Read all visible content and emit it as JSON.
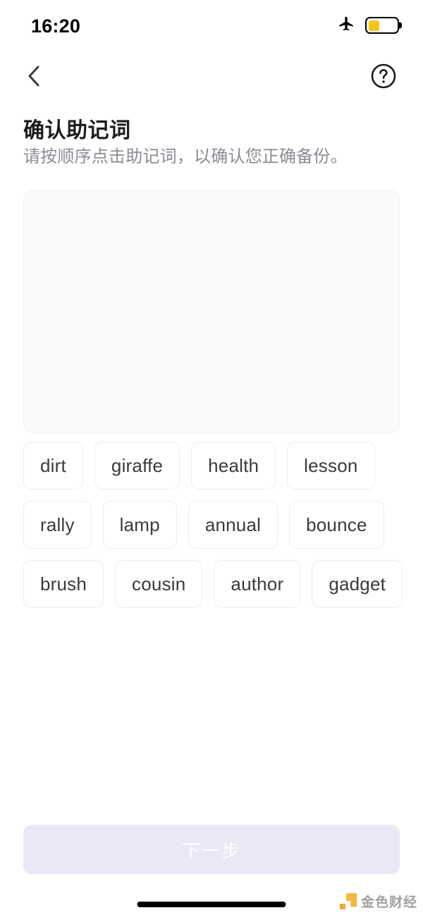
{
  "status_bar": {
    "time": "16:20",
    "airplane_icon": "airplane-mode-icon",
    "battery_icon": "battery-low-power-icon",
    "battery_level_percent": 40,
    "battery_color": "#f5c518"
  },
  "nav": {
    "back_icon": "chevron-left-icon",
    "help_icon": "help-circle-icon"
  },
  "header": {
    "title": "确认助记词",
    "subtitle": "请按顺序点击助记词，以确认您正确备份。"
  },
  "answer_area": {
    "selected_words": [],
    "background_color": "#fafafa",
    "border_color": "#f0f0f0"
  },
  "word_pool": {
    "words": [
      "dirt",
      "giraffe",
      "health",
      "lesson",
      "rally",
      "lamp",
      "annual",
      "bounce",
      "brush",
      "cousin",
      "author",
      "gadget"
    ]
  },
  "footer": {
    "next_label": "下一步",
    "next_disabled": true,
    "next_background_color": "#e8e8f6",
    "next_text_color": "#ffffff"
  },
  "watermark": {
    "text": "金色财经",
    "logo_color": "#f5b335"
  }
}
